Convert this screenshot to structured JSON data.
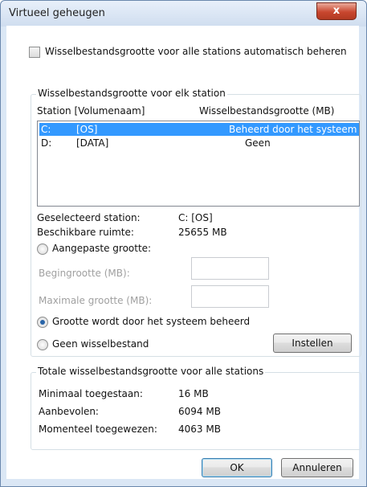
{
  "window": {
    "title": "Virtueel geheugen",
    "close_label": "x"
  },
  "auto_manage": {
    "label": "Wisselbestandsgrootte voor alle stations automatisch beheren",
    "checked": false
  },
  "per_drive": {
    "group_label": "Wisselbestandsgrootte voor elk station",
    "columns": [
      "Station [Volumenaam]",
      "Wisselbestandsgrootte (MB)"
    ],
    "drives": [
      {
        "letter": "C:",
        "name": "[OS]",
        "size": "Beheerd door het systeem",
        "selected": true
      },
      {
        "letter": "D:",
        "name": "[DATA]",
        "size": "Geen",
        "selected": false
      }
    ],
    "selected_drive_label": "Geselecteerd station:",
    "selected_drive_value": "C:  [OS]",
    "available_space_label": "Beschikbare ruimte:",
    "available_space_value": "25655 MB",
    "custom_size_label": "Aangepaste grootte:",
    "initial_size_label": "Begingrootte (MB):",
    "max_size_label": "Maximale grootte (MB):",
    "system_managed_label": "Grootte wordt door het systeem beheerd",
    "no_paging_label": "Geen wisselbestand",
    "set_button": "Instellen",
    "selected_option": "system_managed"
  },
  "totals": {
    "group_label": "Totale wisselbestandsgrootte voor alle stations",
    "min_label": "Minimaal toegestaan:",
    "min_value": "16 MB",
    "recommended_label": "Aanbevolen:",
    "recommended_value": "6094 MB",
    "current_label": "Momenteel toegewezen:",
    "current_value": "4063 MB"
  },
  "buttons": {
    "ok": "OK",
    "cancel": "Annuleren"
  }
}
